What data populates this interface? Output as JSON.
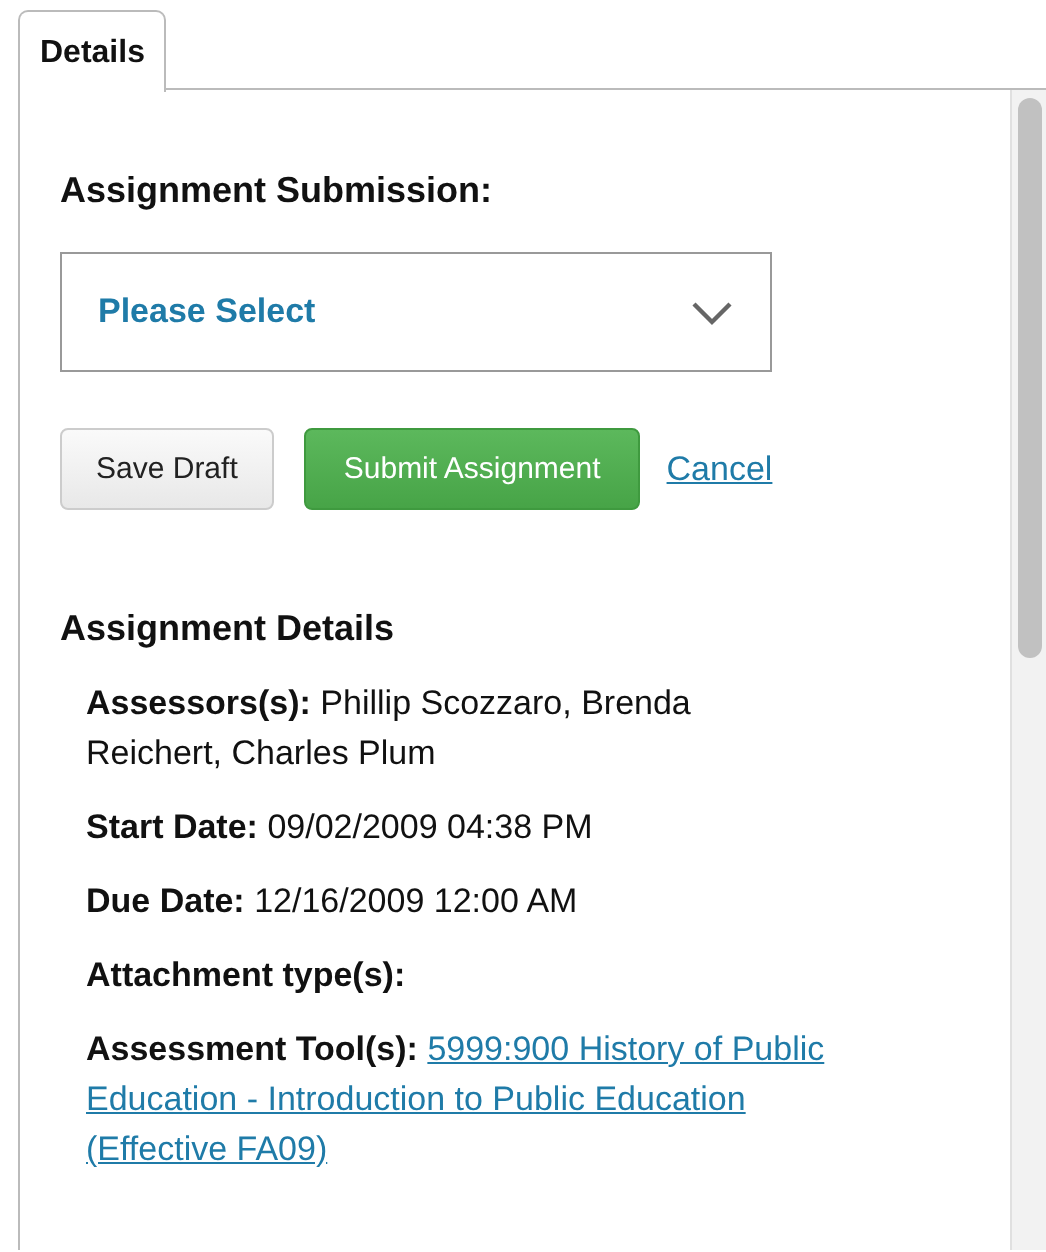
{
  "tabs": [
    {
      "label": "Details",
      "selected": true
    }
  ],
  "submission": {
    "heading": "Assignment Submission:",
    "select": {
      "value": "Please Select"
    }
  },
  "buttons": [
    {
      "label": "Save Draft",
      "kind": "secondary"
    },
    {
      "label": "Submit Assignment",
      "kind": "primary"
    },
    {
      "label": "Cancel",
      "kind": "link"
    }
  ],
  "details": {
    "heading": "Assignment Details",
    "items": [
      {
        "label": "Assessors(s):",
        "value": "Phillip Scozzaro, Brenda Reichert, Charles Plum",
        "kind": "text"
      },
      {
        "label": "Start Date:",
        "value": "09/02/2009 04:38 PM",
        "kind": "text"
      },
      {
        "label": "Due Date:",
        "value": "12/16/2009 12:00 AM",
        "kind": "text"
      },
      {
        "label": "Attachment type(s):",
        "kind": "label"
      },
      {
        "label": "Assessment Tool(s):",
        "value": "5999:900 History of Public Education - Introduction to Public Education (Effective FA09)",
        "kind": "link"
      }
    ]
  }
}
